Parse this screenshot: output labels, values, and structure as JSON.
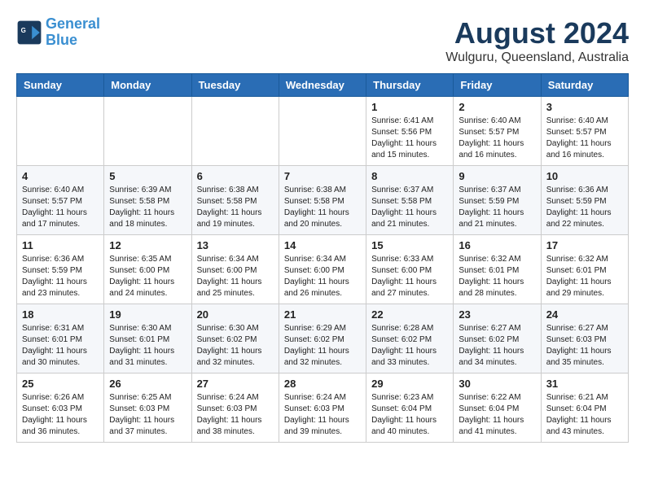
{
  "header": {
    "logo_line1": "General",
    "logo_line2": "Blue",
    "month_year": "August 2024",
    "location": "Wulguru, Queensland, Australia"
  },
  "weekdays": [
    "Sunday",
    "Monday",
    "Tuesday",
    "Wednesday",
    "Thursday",
    "Friday",
    "Saturday"
  ],
  "weeks": [
    [
      {
        "day": "",
        "info": ""
      },
      {
        "day": "",
        "info": ""
      },
      {
        "day": "",
        "info": ""
      },
      {
        "day": "",
        "info": ""
      },
      {
        "day": "1",
        "info": "Sunrise: 6:41 AM\nSunset: 5:56 PM\nDaylight: 11 hours\nand 15 minutes."
      },
      {
        "day": "2",
        "info": "Sunrise: 6:40 AM\nSunset: 5:57 PM\nDaylight: 11 hours\nand 16 minutes."
      },
      {
        "day": "3",
        "info": "Sunrise: 6:40 AM\nSunset: 5:57 PM\nDaylight: 11 hours\nand 16 minutes."
      }
    ],
    [
      {
        "day": "4",
        "info": "Sunrise: 6:40 AM\nSunset: 5:57 PM\nDaylight: 11 hours\nand 17 minutes."
      },
      {
        "day": "5",
        "info": "Sunrise: 6:39 AM\nSunset: 5:58 PM\nDaylight: 11 hours\nand 18 minutes."
      },
      {
        "day": "6",
        "info": "Sunrise: 6:38 AM\nSunset: 5:58 PM\nDaylight: 11 hours\nand 19 minutes."
      },
      {
        "day": "7",
        "info": "Sunrise: 6:38 AM\nSunset: 5:58 PM\nDaylight: 11 hours\nand 20 minutes."
      },
      {
        "day": "8",
        "info": "Sunrise: 6:37 AM\nSunset: 5:58 PM\nDaylight: 11 hours\nand 21 minutes."
      },
      {
        "day": "9",
        "info": "Sunrise: 6:37 AM\nSunset: 5:59 PM\nDaylight: 11 hours\nand 21 minutes."
      },
      {
        "day": "10",
        "info": "Sunrise: 6:36 AM\nSunset: 5:59 PM\nDaylight: 11 hours\nand 22 minutes."
      }
    ],
    [
      {
        "day": "11",
        "info": "Sunrise: 6:36 AM\nSunset: 5:59 PM\nDaylight: 11 hours\nand 23 minutes."
      },
      {
        "day": "12",
        "info": "Sunrise: 6:35 AM\nSunset: 6:00 PM\nDaylight: 11 hours\nand 24 minutes."
      },
      {
        "day": "13",
        "info": "Sunrise: 6:34 AM\nSunset: 6:00 PM\nDaylight: 11 hours\nand 25 minutes."
      },
      {
        "day": "14",
        "info": "Sunrise: 6:34 AM\nSunset: 6:00 PM\nDaylight: 11 hours\nand 26 minutes."
      },
      {
        "day": "15",
        "info": "Sunrise: 6:33 AM\nSunset: 6:00 PM\nDaylight: 11 hours\nand 27 minutes."
      },
      {
        "day": "16",
        "info": "Sunrise: 6:32 AM\nSunset: 6:01 PM\nDaylight: 11 hours\nand 28 minutes."
      },
      {
        "day": "17",
        "info": "Sunrise: 6:32 AM\nSunset: 6:01 PM\nDaylight: 11 hours\nand 29 minutes."
      }
    ],
    [
      {
        "day": "18",
        "info": "Sunrise: 6:31 AM\nSunset: 6:01 PM\nDaylight: 11 hours\nand 30 minutes."
      },
      {
        "day": "19",
        "info": "Sunrise: 6:30 AM\nSunset: 6:01 PM\nDaylight: 11 hours\nand 31 minutes."
      },
      {
        "day": "20",
        "info": "Sunrise: 6:30 AM\nSunset: 6:02 PM\nDaylight: 11 hours\nand 32 minutes."
      },
      {
        "day": "21",
        "info": "Sunrise: 6:29 AM\nSunset: 6:02 PM\nDaylight: 11 hours\nand 32 minutes."
      },
      {
        "day": "22",
        "info": "Sunrise: 6:28 AM\nSunset: 6:02 PM\nDaylight: 11 hours\nand 33 minutes."
      },
      {
        "day": "23",
        "info": "Sunrise: 6:27 AM\nSunset: 6:02 PM\nDaylight: 11 hours\nand 34 minutes."
      },
      {
        "day": "24",
        "info": "Sunrise: 6:27 AM\nSunset: 6:03 PM\nDaylight: 11 hours\nand 35 minutes."
      }
    ],
    [
      {
        "day": "25",
        "info": "Sunrise: 6:26 AM\nSunset: 6:03 PM\nDaylight: 11 hours\nand 36 minutes."
      },
      {
        "day": "26",
        "info": "Sunrise: 6:25 AM\nSunset: 6:03 PM\nDaylight: 11 hours\nand 37 minutes."
      },
      {
        "day": "27",
        "info": "Sunrise: 6:24 AM\nSunset: 6:03 PM\nDaylight: 11 hours\nand 38 minutes."
      },
      {
        "day": "28",
        "info": "Sunrise: 6:24 AM\nSunset: 6:03 PM\nDaylight: 11 hours\nand 39 minutes."
      },
      {
        "day": "29",
        "info": "Sunrise: 6:23 AM\nSunset: 6:04 PM\nDaylight: 11 hours\nand 40 minutes."
      },
      {
        "day": "30",
        "info": "Sunrise: 6:22 AM\nSunset: 6:04 PM\nDaylight: 11 hours\nand 41 minutes."
      },
      {
        "day": "31",
        "info": "Sunrise: 6:21 AM\nSunset: 6:04 PM\nDaylight: 11 hours\nand 43 minutes."
      }
    ]
  ]
}
